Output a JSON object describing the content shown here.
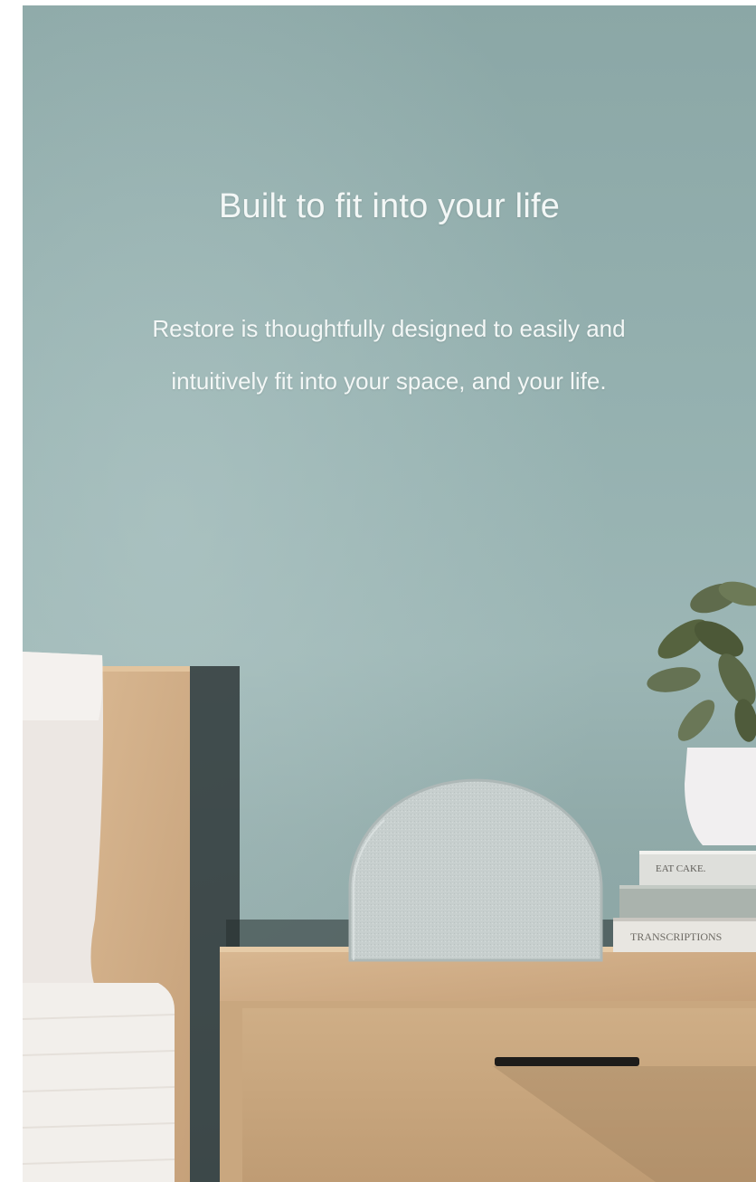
{
  "hero": {
    "headline": "Built to fit into your life",
    "subcopy": "Restore is thoughtfully designed to easily and intuitively fit into your space, and your life."
  },
  "scene": {
    "wall_color": "#93adac",
    "wood_color": "#d4b38d",
    "device_color": "#c9d1d0",
    "book_spine_texts": [
      "EAT CAKE.",
      "TRANSCRIPTIONS"
    ]
  }
}
